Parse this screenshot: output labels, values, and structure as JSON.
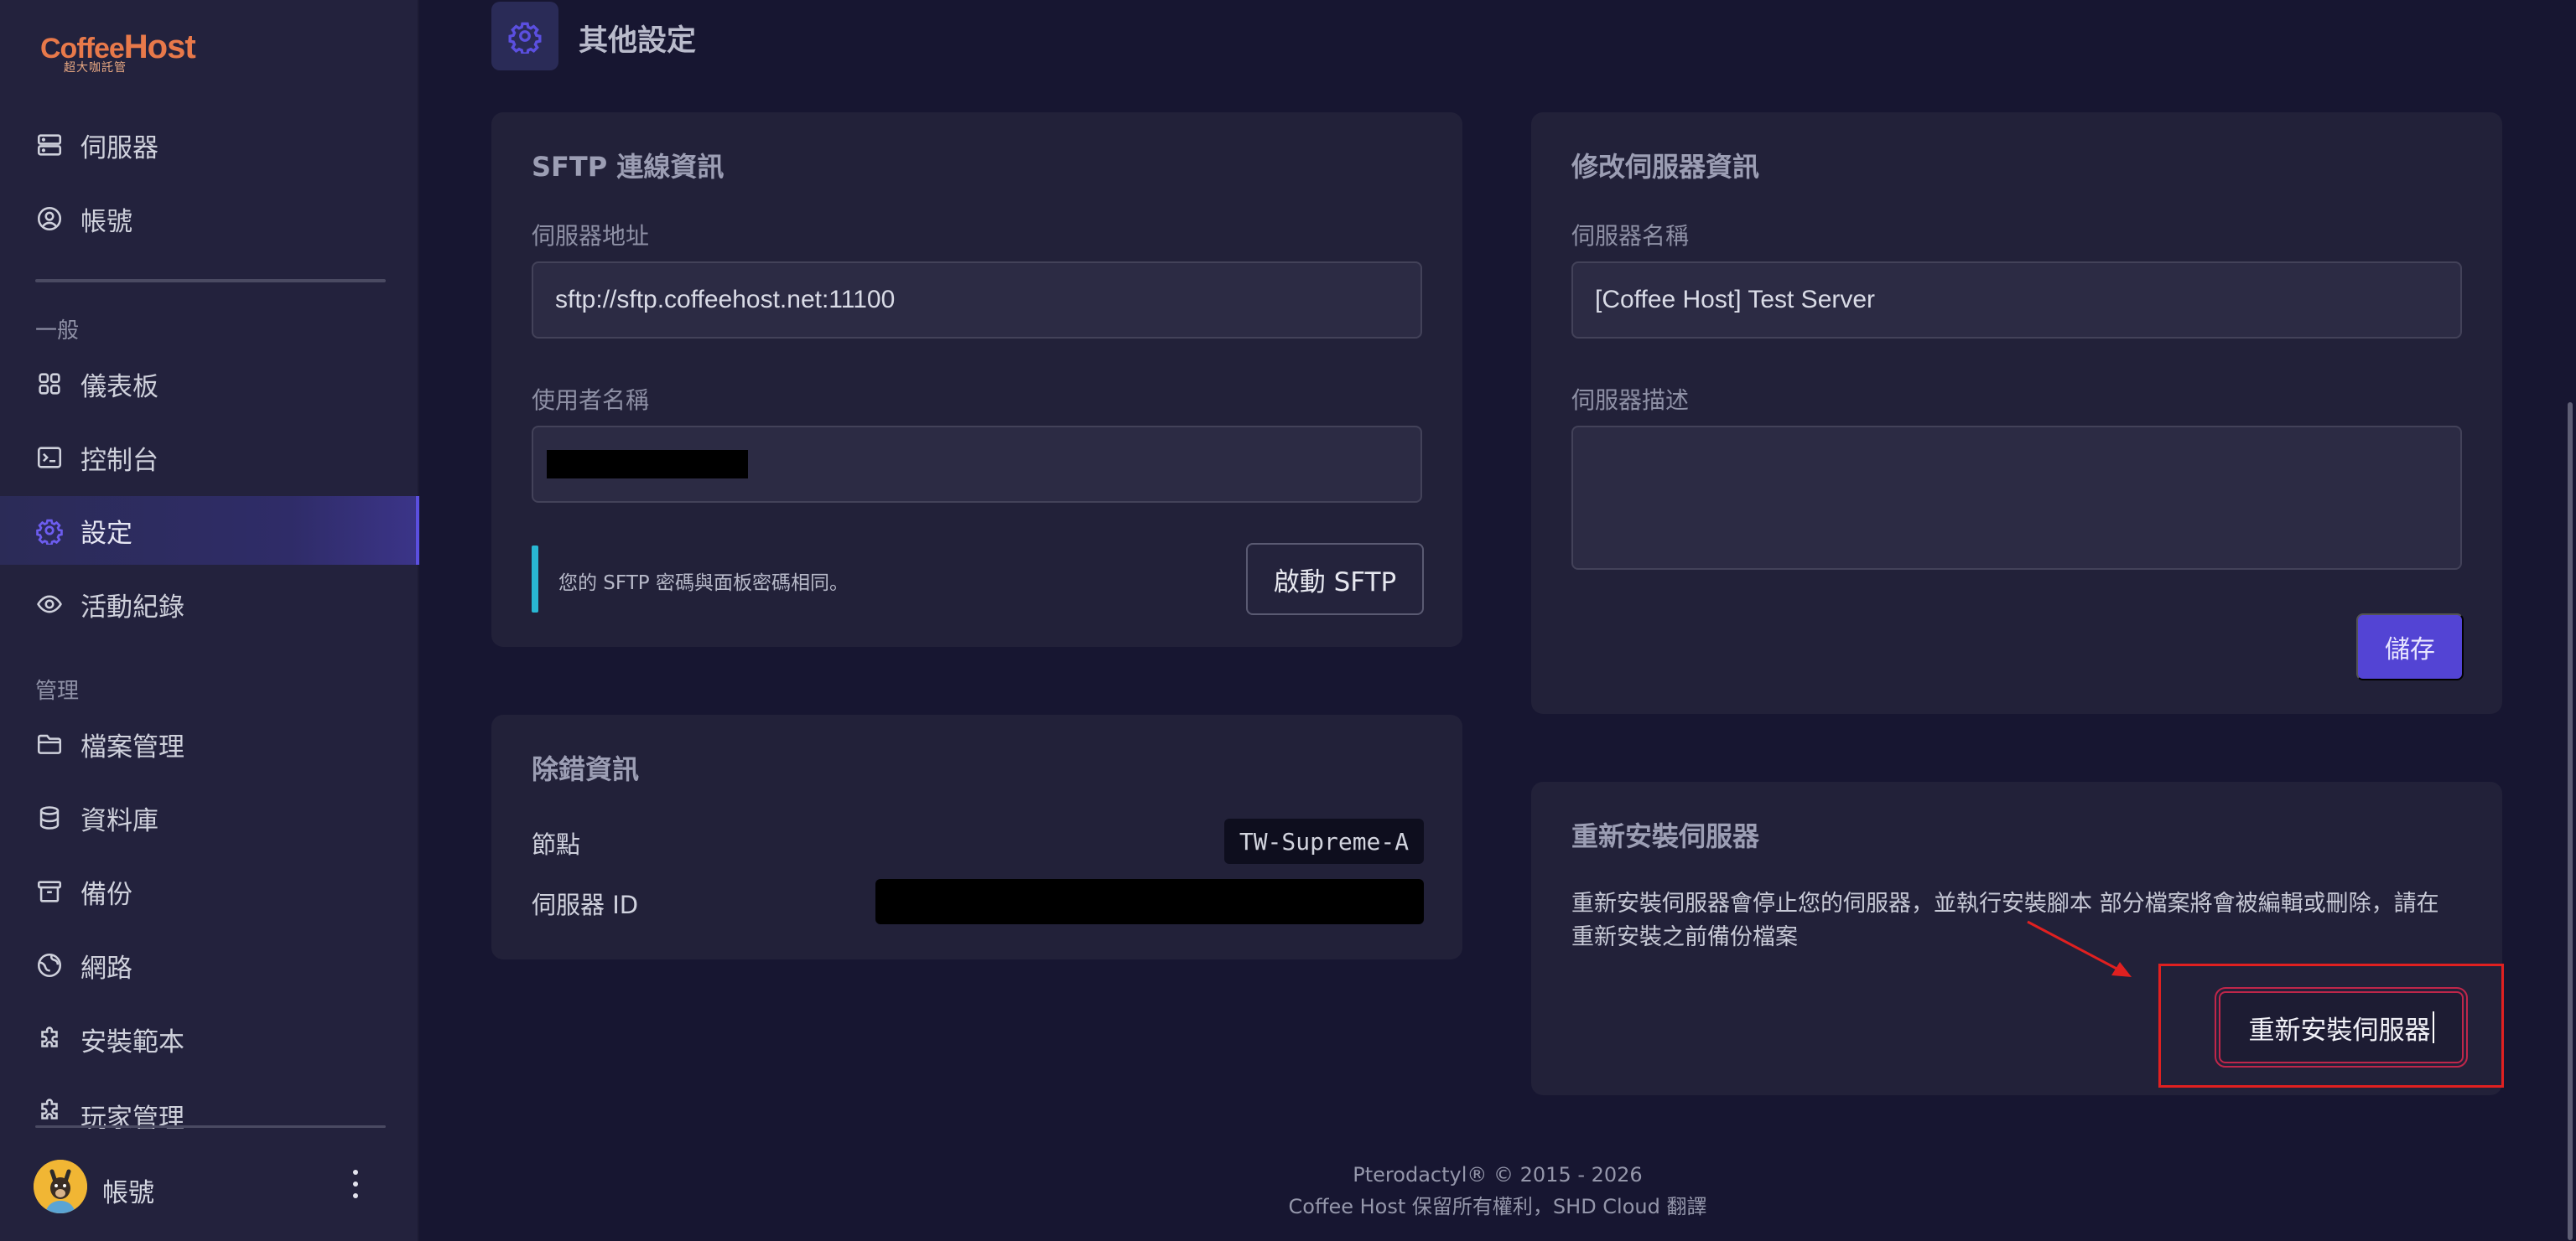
{
  "logo": {
    "line1_a": "Coffee",
    "line1_b": "Host",
    "line2": "超大咖託管"
  },
  "sidebar": {
    "top_items": [
      {
        "label": "伺服器",
        "icon": "server-icon"
      },
      {
        "label": "帳號",
        "icon": "user-circle-icon"
      }
    ],
    "section_general": "一般",
    "general_items": [
      {
        "label": "儀表板",
        "icon": "grid-icon"
      },
      {
        "label": "控制台",
        "icon": "terminal-icon"
      },
      {
        "label": "設定",
        "icon": "gear-icon",
        "active": true
      },
      {
        "label": "活動紀錄",
        "icon": "eye-icon"
      }
    ],
    "section_manage": "管理",
    "manage_items": [
      {
        "label": "檔案管理",
        "icon": "folder-icon"
      },
      {
        "label": "資料庫",
        "icon": "database-icon"
      },
      {
        "label": "備份",
        "icon": "archive-icon"
      },
      {
        "label": "網路",
        "icon": "globe-icon"
      },
      {
        "label": "安裝範本",
        "icon": "puzzle-icon"
      },
      {
        "label": "玩家管理",
        "icon": "puzzle-icon"
      }
    ],
    "account_label": "帳號"
  },
  "page": {
    "title": "其他設定"
  },
  "sftp": {
    "title": "SFTP 連線資訊",
    "address_label": "伺服器地址",
    "address_value": "sftp://sftp.coffeehost.net:11100",
    "username_label": "使用者名稱",
    "info_text": "您的 SFTP 密碼與面板密碼相同。",
    "launch_button": "啟動 SFTP"
  },
  "edit_server": {
    "title": "修改伺服器資訊",
    "name_label": "伺服器名稱",
    "name_value": "[Coffee Host] Test Server",
    "desc_label": "伺服器描述",
    "desc_value": "",
    "save_button": "儲存"
  },
  "debug": {
    "title": "除錯資訊",
    "node_label": "節點",
    "node_value": "TW-Supreme-A",
    "server_id_label": "伺服器 ID"
  },
  "reinstall": {
    "title": "重新安裝伺服器",
    "description": "重新安裝伺服器會停止您的伺服器，並執行安裝腳本 部分檔案將會被編輯或刪除，請在重新安裝之前備份檔案",
    "button": "重新安裝伺服器"
  },
  "footer": {
    "line1": "Pterodactyl® © 2015 - 2026",
    "line2": "Coffee Host 保留所有權利，SHD Cloud 翻譯"
  },
  "colors": {
    "accent": "#5344d4",
    "annotation": "#e02020",
    "info_bar": "#29b7d3",
    "logo": "#e8794a"
  }
}
